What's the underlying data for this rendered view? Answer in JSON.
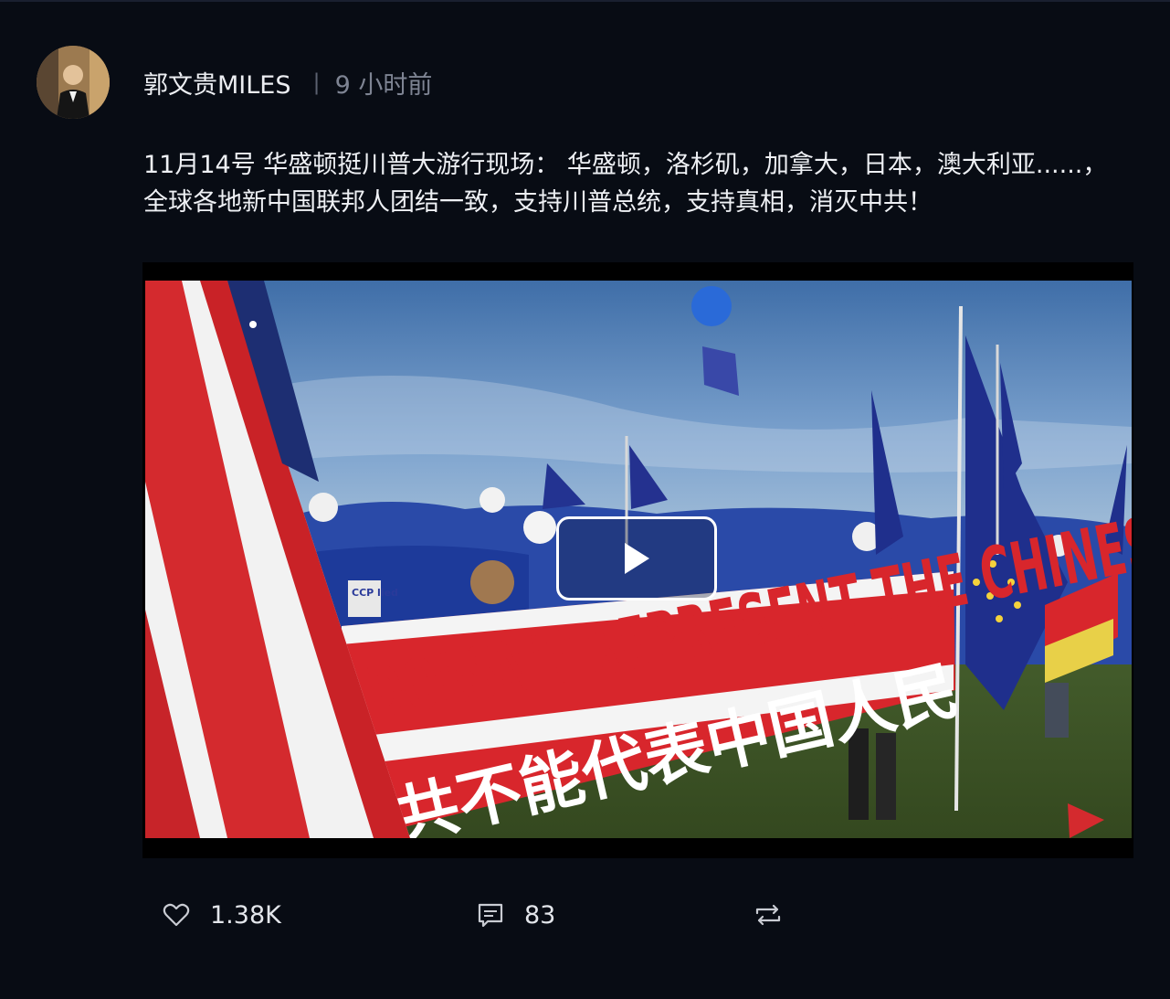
{
  "post": {
    "author": "郭文贵MILES",
    "separator": "|",
    "time": "9 小时前",
    "text": "11月14号 华盛顿挺川普大游行现场： 华盛顿，洛杉矶，加拿大，日本，澳大利亚......，全球各地新中国联邦人团结一致，支持川普总统，支持真相，消灭中共！"
  },
  "video": {
    "banner_english": "DOESN'T REPRESENT THE CHINESE",
    "banner_chinese": "共不能代表中国人民",
    "sign_text": "CCP lied"
  },
  "actions": {
    "likes": "1.38K",
    "comments": "83"
  },
  "icons": {
    "like": "heart-icon",
    "comment": "comment-icon",
    "repost": "repost-icon",
    "play": "play-icon"
  },
  "colors": {
    "background": "#080c14",
    "banner_red": "#d8262c",
    "flag_blue": "#1f2f8c"
  }
}
